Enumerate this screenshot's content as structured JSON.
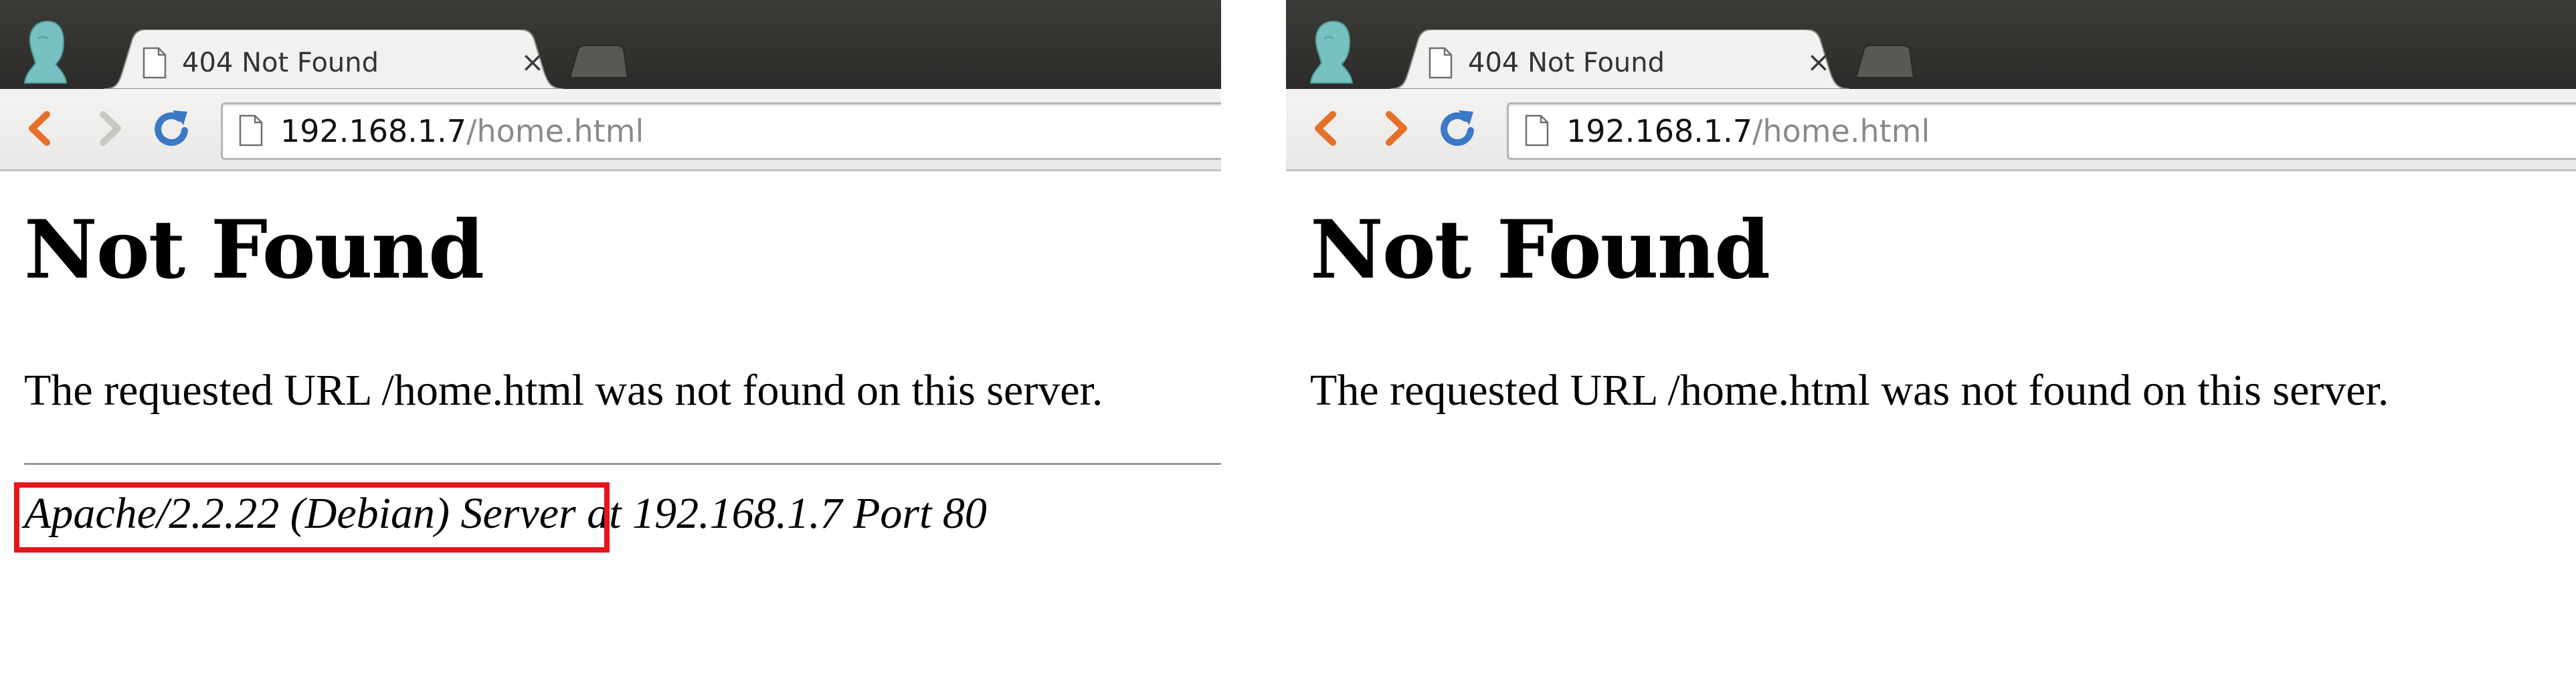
{
  "left": {
    "tab": {
      "title": "404 Not Found",
      "close_label": "×"
    },
    "address_bar": {
      "host": "192.168.1.7",
      "path": "/home.html"
    },
    "page": {
      "heading": "Not Found",
      "message": "The requested URL /home.html was not found on this server.",
      "server_product": "Apache/2.2.22 (Debian) Server",
      "server_location": " at 192.168.1.7 Port 80"
    },
    "forward_enabled": false
  },
  "right": {
    "tab": {
      "title": "404 Not Found",
      "close_label": "×"
    },
    "address_bar": {
      "host": "192.168.1.7",
      "path": "/home.html"
    },
    "page": {
      "heading": "Not Found",
      "message": "The requested URL /home.html was not found on this server."
    },
    "forward_enabled": true
  },
  "icons": {
    "profile": "profile-avatar-icon",
    "page": "page-icon",
    "back": "back-arrow-icon",
    "forward": "forward-arrow-icon",
    "reload": "reload-icon",
    "close": "close-icon",
    "new_tab": "new-tab-icon"
  },
  "colors": {
    "tabstrip": "#2c2b29",
    "toolbar": "#efeeec",
    "nav_active": "#e4702a",
    "nav_disabled": "#c9c7c4",
    "reload": "#3b79c7",
    "url_path": "#8a8a8a",
    "highlight": "#e5151b",
    "profile": "#77c2c0"
  }
}
